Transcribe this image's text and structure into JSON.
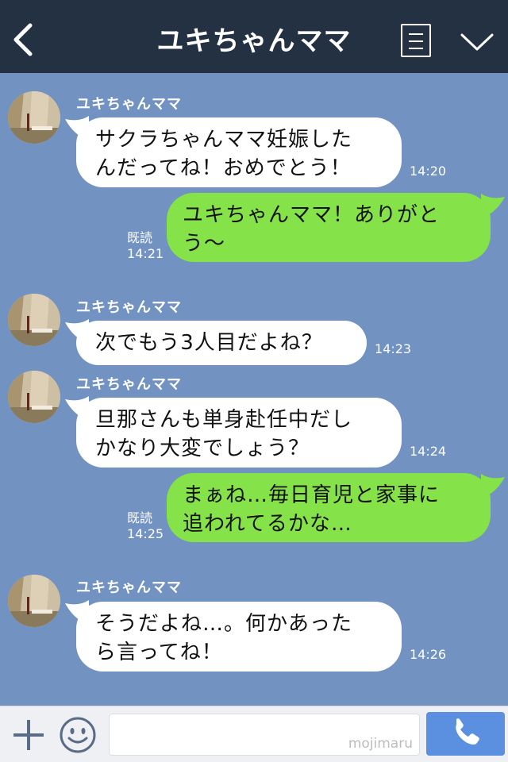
{
  "header": {
    "title": "ユキちゃんママ",
    "back_icon": "chevron-left-icon",
    "menu_icon": "menu-list-icon",
    "collapse_icon": "chevron-down-icon",
    "background": "#243142"
  },
  "chat": {
    "background": "#7292c2",
    "incoming_bubble_color": "#ffffff",
    "outgoing_bubble_color": "#85e249",
    "messages": [
      {
        "direction": "incoming",
        "sender": "ユキちゃんママ",
        "lines": [
          "サクラちゃんママ妊娠した",
          "んだってね！おめでとう！"
        ],
        "time": "14:20"
      },
      {
        "direction": "outgoing",
        "read_label": "既読",
        "lines": [
          "ユキちゃんママ！ありがと",
          "う〜"
        ],
        "time": "14:21"
      },
      {
        "direction": "incoming",
        "sender": "ユキちゃんママ",
        "lines": [
          "次でもう3人目だよね？"
        ],
        "time": "14:23"
      },
      {
        "direction": "incoming",
        "sender": "ユキちゃんママ",
        "lines": [
          "旦那さんも単身赴任中だし",
          "かなり大変でしょう？"
        ],
        "time": "14:24"
      },
      {
        "direction": "outgoing",
        "read_label": "既読",
        "lines": [
          "まぁね…毎日育児と家事に",
          "追われてるかな…"
        ],
        "time": "14:25"
      },
      {
        "direction": "incoming",
        "sender": "ユキちゃんママ",
        "lines": [
          "そうだよね…。何かあった",
          "ら言ってね！"
        ],
        "time": "14:26"
      }
    ]
  },
  "footer": {
    "plus_icon": "plus-icon",
    "emoji_icon": "smiley-icon",
    "input_value": "",
    "watermark": "mojimaru",
    "send_icon": "phone-icon",
    "send_color": "#5b8fe0"
  }
}
